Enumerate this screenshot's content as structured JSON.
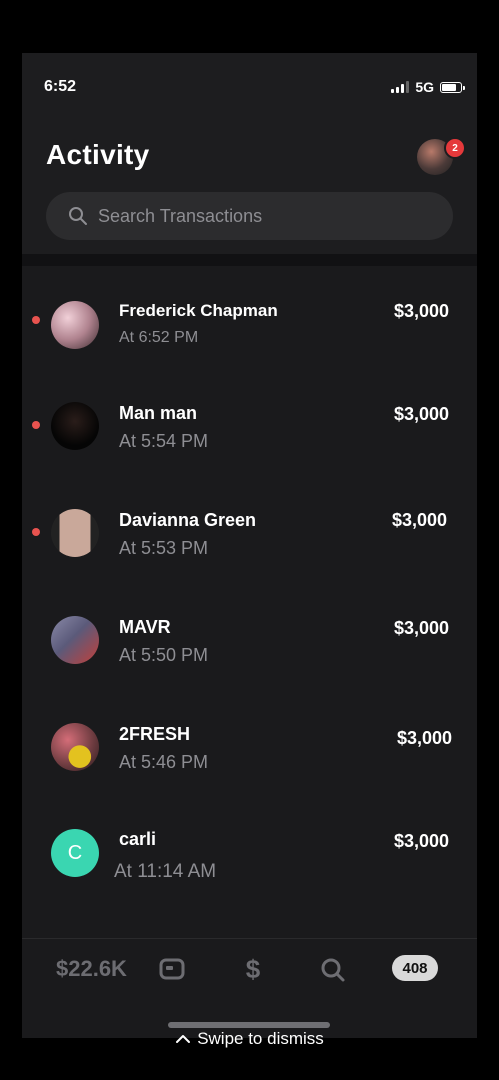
{
  "status_bar": {
    "time": "6:52",
    "network": "5G"
  },
  "header": {
    "title": "Activity",
    "notification_count": "2"
  },
  "search": {
    "placeholder": "Search Transactions"
  },
  "transactions": [
    {
      "name": "Frederick Chapman",
      "time": "At 6:52 PM",
      "amount": "$3,000",
      "unread": true
    },
    {
      "name": "Man man",
      "time": "At 5:54 PM",
      "amount": "$3,000",
      "unread": true
    },
    {
      "name": "Davianna Green",
      "time": "At 5:53 PM",
      "amount": "$3,000",
      "unread": true
    },
    {
      "name": "MAVR",
      "time": "At 5:50 PM",
      "amount": "$3,000",
      "unread": false
    },
    {
      "name": "2FRESH",
      "time": "At 5:46 PM",
      "amount": "$3,000",
      "unread": false
    },
    {
      "name": "carli",
      "time": "At 11:14 AM",
      "amount": "$3,000",
      "unread": false,
      "initial": "C"
    }
  ],
  "tabbar": {
    "balance": "$22.6K",
    "activity_count": "408"
  },
  "footer": {
    "swipe_text": "Swipe to dismiss"
  },
  "colors": {
    "unread_dot": "#e8534f",
    "letter_avatar": "#3ad6b1",
    "badge": "#e5393b"
  }
}
